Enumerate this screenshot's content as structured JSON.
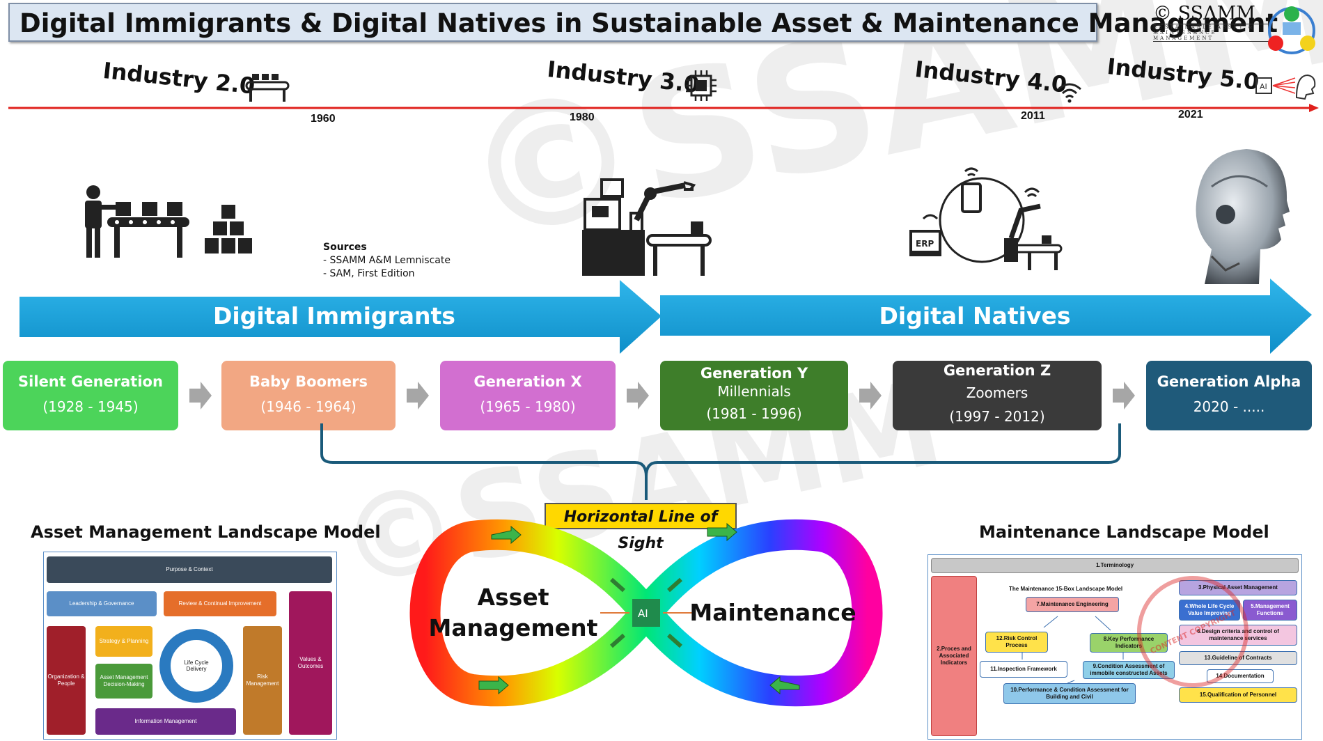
{
  "title": "Digital Immigrants & Digital Natives in Sustainable Asset & Maintenance Management",
  "logo": {
    "text": "© SSΛMM",
    "subtitle": "SUSTAINABLE ASSET & MAINTENANCE MANAGEMENT"
  },
  "watermark": "©SSAMM",
  "timeline": {
    "industries": [
      {
        "label": "Industry 2.0",
        "year": "1960"
      },
      {
        "label": "Industry 3.0",
        "year": "1980"
      },
      {
        "label": "Industry 4.0",
        "year": "2011"
      },
      {
        "label": "Industry 5.0",
        "year": "2021"
      }
    ]
  },
  "icons": {
    "erp_label": "ERP",
    "ai_label": "AI"
  },
  "sources": {
    "heading": "Sources",
    "items": [
      "- SSAMM A&M Lemniscate",
      "- SAM, First Edition"
    ]
  },
  "banners": {
    "immigrants": "Digital Immigrants",
    "natives": "Digital Natives"
  },
  "generations": [
    {
      "name": "Silent Generation",
      "sub": "",
      "years": "(1928 - 1945)",
      "color": "#4cd45a",
      "text_color": "#ffffff"
    },
    {
      "name": "Baby Boomers",
      "sub": "",
      "years": "(1946 - 1964)",
      "color": "#f2a783",
      "text_color": "#ffffff"
    },
    {
      "name": "Generation X",
      "sub": "",
      "years": "(1965 - 1980)",
      "color": "#d26fd0",
      "text_color": "#ffffff"
    },
    {
      "name": "Generation Y",
      "sub": "Millennials",
      "years": "(1981 - 1996)",
      "color": "#3e7e2a",
      "text_color": "#ffffff"
    },
    {
      "name": "Generation Z",
      "sub": "Zoomers",
      "years": "(1997 - 2012)",
      "color": "#3a3a3a",
      "text_color": "#ffffff"
    },
    {
      "name": "Generation Alpha",
      "sub": "",
      "years": "2020 - .....",
      "color": "#1f5a7a",
      "text_color": "#ffffff"
    }
  ],
  "line_of_sight": "Horizontal Line of Sight",
  "lemniscate": {
    "left": "Asset\nManagement",
    "left_line1": "Asset",
    "left_line2": "Management",
    "right": "Maintenance"
  },
  "am_model": {
    "title": "Asset Management Landscape Model",
    "purpose": "Purpose & Context",
    "leadership": "Leadership & Governance",
    "review": "Review & Continual Improvement",
    "strategy": "Strategy & Planning",
    "decision": "Asset Management Decision-Making",
    "lifecycle": "Life Cycle Delivery",
    "org": "Organization & People",
    "risk": "Risk Management",
    "values": "Values & Outcomes",
    "info": "Information Management"
  },
  "ml_model": {
    "title": "Maintenance Landscape Model",
    "terminology": "1.Terminology",
    "subtitle": "The Maintenance 15-Box Landscape Model",
    "b2": "2.Proces and Associated Indicators",
    "b3": "3.Physical Asset Management",
    "b4": "4.Whole Life Cycle Value Improving",
    "b5": "5.Management Functions",
    "b6": "6.Design criteria and control of maintenance services",
    "b7": "7.Maintenance Engineering",
    "b8": "8.Key Performance Indicators",
    "b9": "9.Condition Assessment of immobile constructed Assets",
    "b10": "10.Performance & Condition Assessment for Building and Civil",
    "b11": "11.Inspection Framework",
    "b12": "12.Risk Control Process",
    "b13": "13.Guideline of Contracts",
    "b14": "14.Documentation",
    "b15": "15.Qualification of Personnel",
    "stamp": "CONTENT COPYRIGHT"
  },
  "colors": {
    "timeline": "#e0201c",
    "banner": "#1fa9e1",
    "bracket": "#1a5a7a"
  }
}
